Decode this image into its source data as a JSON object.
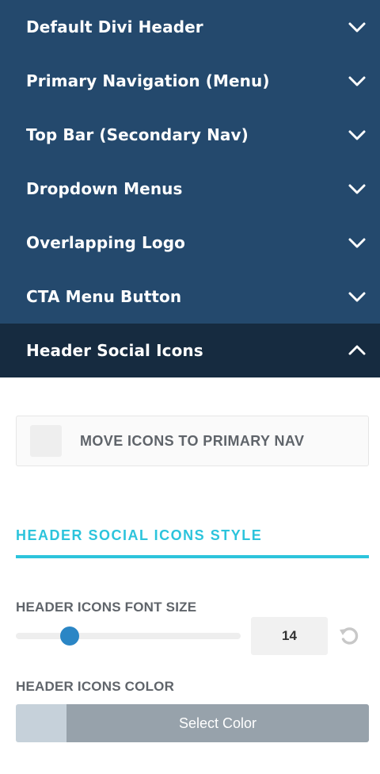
{
  "accordion": {
    "items": [
      {
        "label": "Default Divi Header",
        "state": "collapsed"
      },
      {
        "label": "Primary Navigation (Menu)",
        "state": "collapsed"
      },
      {
        "label": "Top Bar (Secondary Nav)",
        "state": "collapsed"
      },
      {
        "label": "Dropdown Menus",
        "state": "collapsed"
      },
      {
        "label": "Overlapping Logo",
        "state": "collapsed"
      },
      {
        "label": "CTA Menu Button",
        "state": "collapsed"
      },
      {
        "label": "Header Social Icons",
        "state": "expanded"
      }
    ]
  },
  "panel": {
    "move_icons": {
      "label": "MOVE ICONS TO PRIMARY NAV",
      "checked": false
    },
    "section_title": "HEADER SOCIAL ICONS STYLE",
    "font_size": {
      "label": "HEADER ICONS FONT SIZE",
      "value": "14"
    },
    "color": {
      "label": "HEADER ICONS COLOR",
      "button_label": "Select Color"
    }
  },
  "colors": {
    "header_bg": "#24496d",
    "active_bg": "#162b40",
    "accent": "#2cc4dc",
    "slider_thumb": "#2b86c5",
    "color_swatch": "#c6d1da",
    "color_button": "#97a2ab"
  },
  "icons": {
    "collapsed": "chevron-down-icon",
    "expanded": "chevron-up-icon",
    "reset": "reset-icon"
  }
}
